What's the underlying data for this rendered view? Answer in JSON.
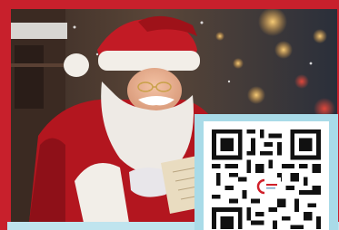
{
  "colors": {
    "frame": "#c8202c",
    "qr_border": "#a9dbe8",
    "bottom_strip": "#bfe4ee",
    "santa_suit": "#b3161f",
    "fur": "#f2eee8"
  },
  "photo": {
    "subject": "santa-reading-letter-photo"
  },
  "qr": {
    "icon": "qr-code-icon",
    "logo_icon": "logo-icon"
  }
}
